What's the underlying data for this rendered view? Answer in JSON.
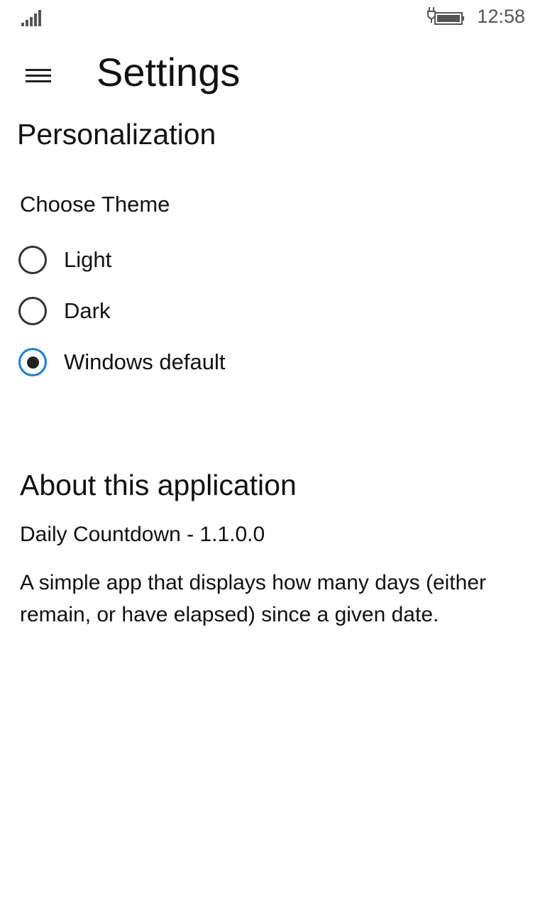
{
  "status_bar": {
    "time": "12:58",
    "signal_icon": "signal-strength-icon",
    "battery_icon": "battery-charging-icon"
  },
  "header": {
    "title": "Settings",
    "menu_icon": "hamburger-menu-icon"
  },
  "personalization": {
    "heading": "Personalization",
    "theme_label": "Choose Theme",
    "options": [
      {
        "label": "Light",
        "selected": false
      },
      {
        "label": "Dark",
        "selected": false
      },
      {
        "label": "Windows default",
        "selected": true
      }
    ],
    "accent_color": "#1780d8"
  },
  "about": {
    "heading": "About this application",
    "version": "Daily Countdown - 1.1.0.0",
    "description": "A simple app that displays how many days (either remain, or have elapsed) since a given date."
  }
}
